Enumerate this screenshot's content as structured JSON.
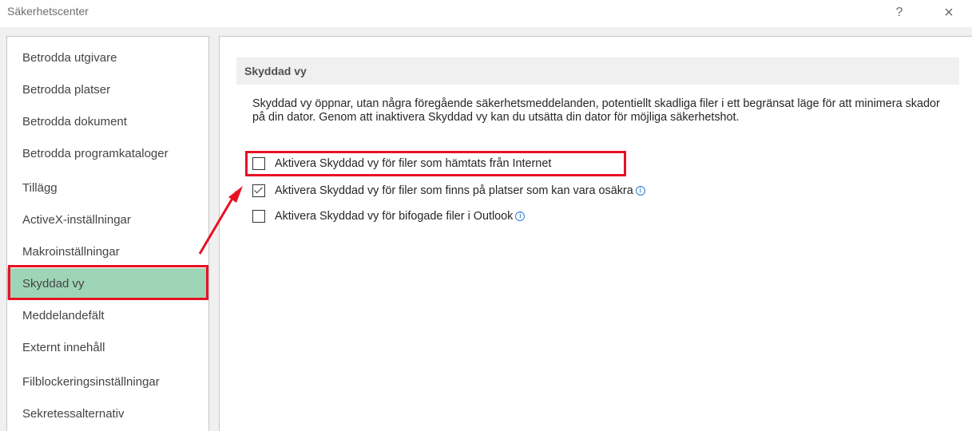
{
  "window": {
    "title": "Säkerhetscenter",
    "help_label": "?",
    "close_label": "×"
  },
  "sidebar": {
    "items": [
      {
        "label": "Betrodda utgivare"
      },
      {
        "label": "Betrodda platser"
      },
      {
        "label": "Betrodda dokument"
      },
      {
        "label": "Betrodda programkataloger"
      },
      {
        "label": "Tillägg"
      },
      {
        "label": "ActiveX-inställningar"
      },
      {
        "label": "Makroinställningar"
      },
      {
        "label": "Skyddad vy"
      },
      {
        "label": "Meddelandefält"
      },
      {
        "label": "Externt innehåll"
      },
      {
        "label": "Filblockeringsinställningar"
      },
      {
        "label": "Sekretessalternativ"
      }
    ],
    "selected_index": 7
  },
  "main": {
    "section_title": "Skyddad vy",
    "description": "Skyddad vy öppnar, utan några föregående säkerhetsmeddelanden, potentiellt skadliga filer i ett begränsat läge för att minimera skador på din dator. Genom att inaktivera Skyddad vy kan du utsätta din dator för möjliga säkerhetshot.",
    "options": [
      {
        "label": "Aktivera Skyddad vy för filer som hämtats från Internet",
        "checked": false,
        "info": false
      },
      {
        "label": "Aktivera Skyddad vy för filer som finns på platser som kan vara osäkra",
        "checked": true,
        "info": true
      },
      {
        "label": "Aktivera Skyddad vy för bifogade filer i Outlook",
        "checked": false,
        "info": true
      }
    ],
    "info_glyph": "i"
  },
  "colors": {
    "selected_bg": "#9fd5b7",
    "highlight": "#e81123",
    "info": "#2b7cd3"
  }
}
